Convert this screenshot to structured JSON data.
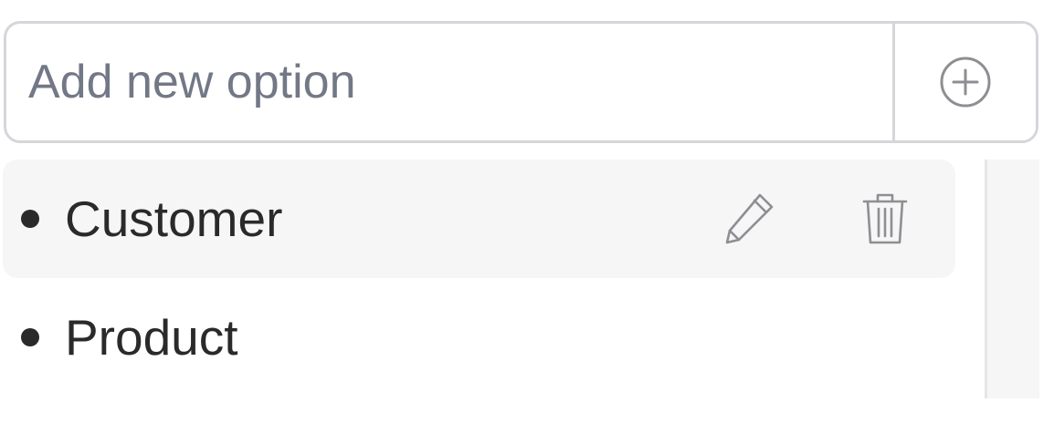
{
  "add_option": {
    "placeholder": "Add new option",
    "value": "",
    "add_icon": "plus-circle-icon"
  },
  "options": [
    {
      "label": "Customer",
      "hovered": true,
      "edit_icon": "pencil-icon",
      "delete_icon": "trash-icon"
    },
    {
      "label": "Product",
      "hovered": false
    }
  ],
  "colors": {
    "border": "#d5d6da",
    "placeholder": "#737886",
    "text": "#2a2a2a",
    "hover_bg": "#f6f6f7",
    "icon": "#8e8e93"
  }
}
